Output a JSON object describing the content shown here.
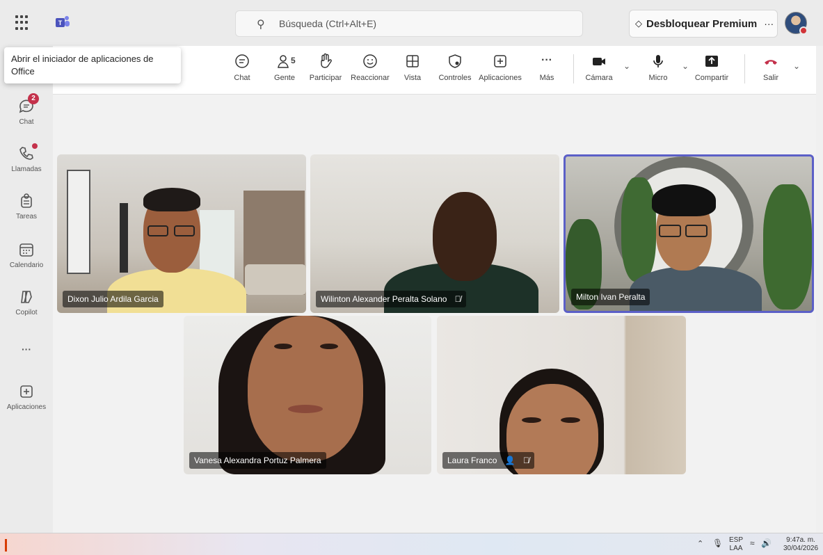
{
  "app": {
    "search_placeholder": "Búsqueda (Ctrl+Alt+E)",
    "premium_label": "Desbloquear Premium",
    "premium_more": "···",
    "tooltip": "Abrir el iniciador de aplicaciones de Office"
  },
  "rail": [
    {
      "label": "Chat",
      "icon": "chat-icon",
      "badge": "2"
    },
    {
      "label": "Llamadas",
      "icon": "phone-icon"
    },
    {
      "label": "Tareas",
      "icon": "tasks-icon"
    },
    {
      "label": "Calendario",
      "icon": "calendar-icon"
    },
    {
      "label": "Copilot",
      "icon": "copilot-icon"
    },
    {
      "label": "···",
      "icon": "more-icon"
    },
    {
      "label": "Aplicaciones",
      "icon": "add-apps-icon"
    }
  ],
  "toolbar": {
    "chat": "Chat",
    "people": "Gente",
    "people_count": "5",
    "raise": "Participar",
    "react": "Reaccionar",
    "view": "Vista",
    "controls": "Controles",
    "apps": "Aplicaciones",
    "more": "Más",
    "camera": "Cámara",
    "mic": "Micro",
    "share": "Compartir",
    "leave": "Salir"
  },
  "participants": [
    {
      "name": "Dixon Julio Ardila Garcia",
      "muted": false
    },
    {
      "name": "Wilinton Alexander Peralta Solano",
      "muted": true
    },
    {
      "name": "Milton Ivan Peralta",
      "muted": false,
      "active": true
    },
    {
      "name": "Vanesa Alexandra Portuz Palmera",
      "muted": false
    },
    {
      "name": "Laura Franco",
      "muted": true,
      "organizer": true
    }
  ],
  "taskbar": {
    "lang_top": "ESP",
    "lang_bottom": "LAA",
    "time": "9:47a. m.",
    "date": "30/04/2026"
  },
  "colors": {
    "accent": "#5b5fc7",
    "leave": "#c4314b",
    "badge": "#c4314b"
  }
}
